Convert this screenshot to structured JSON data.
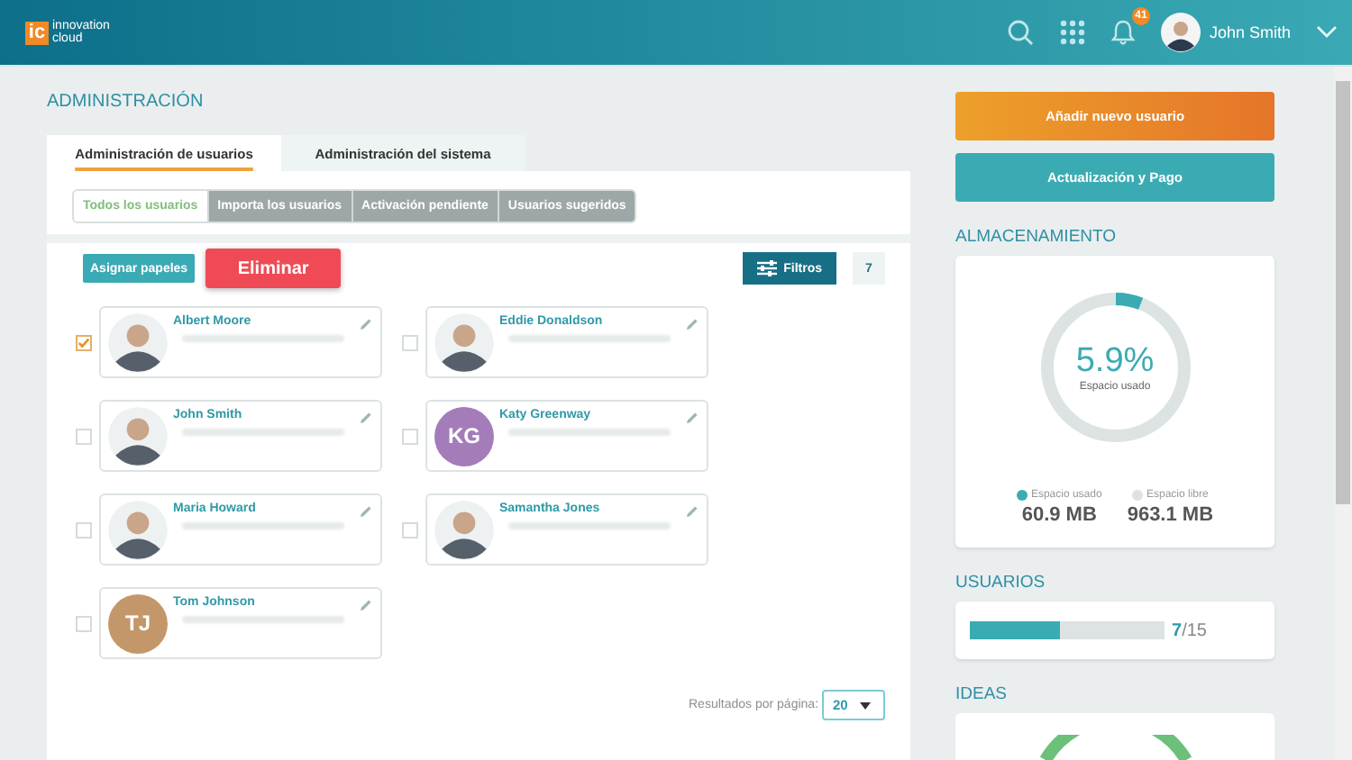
{
  "header": {
    "logo_mark": "ic",
    "logo_lines": [
      "innovation",
      "cloud"
    ],
    "notifications": "41",
    "user_name": "John Smith"
  },
  "title": "ADMINISTRACIÓN",
  "tabs": [
    {
      "label": "Administración de usuarios",
      "selected": true
    },
    {
      "label": "Administración del sistema",
      "selected": false
    }
  ],
  "subtabs": [
    {
      "label": "Todos los usuarios",
      "selected": true
    },
    {
      "label": "Importa los usuarios",
      "selected": false
    },
    {
      "label": "Activación pendiente",
      "selected": false
    },
    {
      "label": "Usuarios sugeridos",
      "selected": false
    }
  ],
  "actions": {
    "assign": "Asignar papeles",
    "delete": "Eliminar",
    "filters": "Filtros",
    "count": "7"
  },
  "users": [
    {
      "name": "Albert Moore",
      "checked": true,
      "avatar": {
        "kind": "photo"
      }
    },
    {
      "name": "Eddie Donaldson",
      "checked": false,
      "avatar": {
        "kind": "photo"
      }
    },
    {
      "name": "John Smith",
      "checked": false,
      "avatar": {
        "kind": "photo"
      }
    },
    {
      "name": "Katy Greenway",
      "checked": false,
      "avatar": {
        "kind": "initials",
        "initials": "KG",
        "color": "#a47cb9"
      }
    },
    {
      "name": "Maria Howard",
      "checked": false,
      "avatar": {
        "kind": "photo"
      }
    },
    {
      "name": "Samantha Jones",
      "checked": false,
      "avatar": {
        "kind": "photo"
      }
    },
    {
      "name": "Tom Johnson",
      "checked": false,
      "avatar": {
        "kind": "initials",
        "initials": "TJ",
        "color": "#c4976a"
      }
    }
  ],
  "pagination": {
    "label": "Resultados por página:",
    "value": "20"
  },
  "side": {
    "buttons": [
      "Añadir nuevo usuario",
      "Actualización y Pago"
    ],
    "storage": {
      "title": "ALMACENAMIENTO",
      "percent": "5.9%",
      "caption": "Espacio usado",
      "level": 0.059,
      "legend": [
        {
          "label": "Espacio usado",
          "value": "60.9 MB",
          "color": "#3aabb3"
        },
        {
          "label": "Espacio libre",
          "value": "963.1 MB",
          "color": "#dde3e3"
        }
      ]
    },
    "users": {
      "title": "USUARIOS",
      "level": 0.467,
      "count": "**7**/15"
    },
    "ideas": {
      "title": "IDEAS"
    }
  }
}
